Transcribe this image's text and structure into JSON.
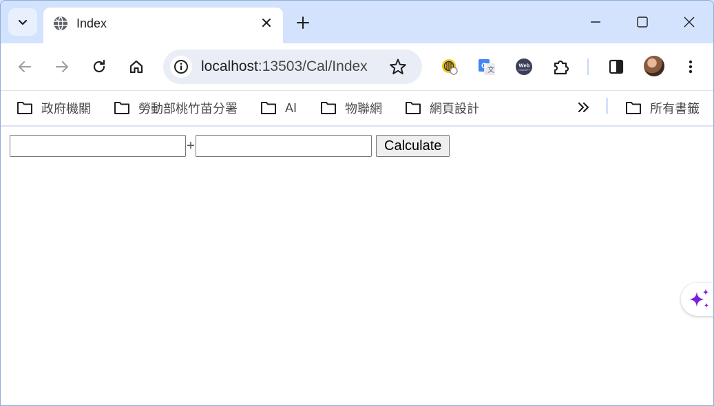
{
  "tab": {
    "title": "Index"
  },
  "address_bar": {
    "host": "localhost",
    "rest": ":13503/Cal/Index"
  },
  "bookmarks": {
    "items": [
      {
        "label": "政府機關"
      },
      {
        "label": "勞動部桃竹苗分署"
      },
      {
        "label": "AI"
      },
      {
        "label": "物聯網"
      },
      {
        "label": "網頁設計"
      }
    ],
    "all_bookmarks": "所有書籤"
  },
  "extensions": [
    "keeper-icon",
    "google-translate-icon",
    "webchatgpt-icon",
    "extensions-puzzle-icon"
  ],
  "page": {
    "input1_value": "",
    "plus_label": "+",
    "input2_value": "",
    "calculate_label": "Calculate"
  },
  "colors": {
    "tab_strip": "#d3e3fd",
    "omnibox": "#e9eef6",
    "ai_sparkle": "#7b1fd8"
  }
}
